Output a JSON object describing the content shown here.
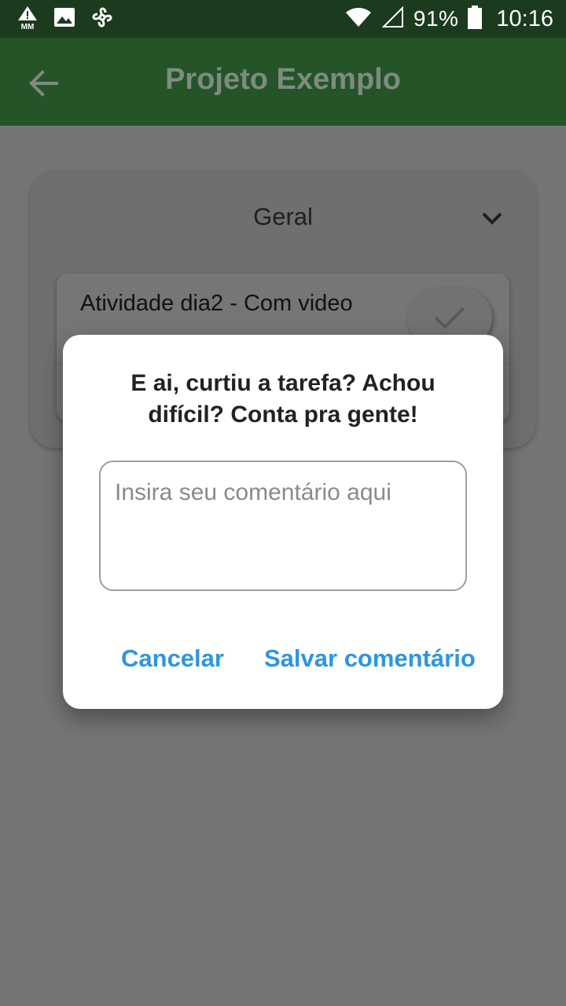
{
  "status_bar": {
    "icons": [
      "warning-mm-icon",
      "image-icon",
      "fan-icon",
      "wifi-icon",
      "signal-icon",
      "battery-icon"
    ],
    "battery": "91%",
    "time": "10:16"
  },
  "app_bar": {
    "title": "Projeto Exemplo",
    "back_icon": "arrow-left-icon"
  },
  "section": {
    "title": "Geral",
    "expand_icon": "chevron-down-icon"
  },
  "task": {
    "title": "Atividade dia2 - Com video",
    "done_icon": "check-icon"
  },
  "dialog": {
    "title": "E ai, curtiu a tarefa? Achou difícil? Conta pra gente!",
    "input_placeholder": "Insira seu comentário aqui",
    "input_value": "",
    "cancel_label": "Cancelar",
    "save_label": "Salvar comentário"
  },
  "colors": {
    "app_bar": "#245428",
    "status_bar": "#1b3a1e",
    "accent": "#2d96df",
    "scrim": "#757575"
  }
}
